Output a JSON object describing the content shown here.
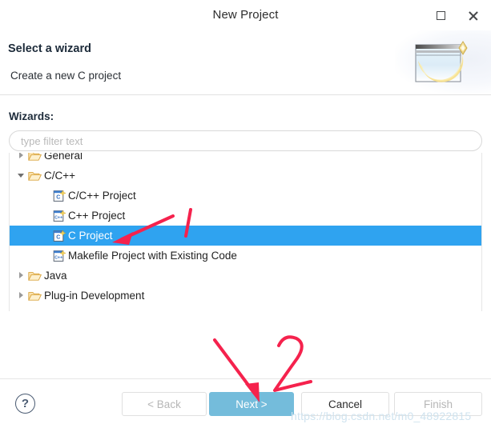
{
  "window": {
    "title": "New Project",
    "controls": [
      {
        "name": "maximize",
        "label": "Maximize"
      },
      {
        "name": "close",
        "label": "Close"
      }
    ]
  },
  "banner": {
    "title": "Select a wizard",
    "subtitle": "Create a new C project",
    "icon": "new-project-wizard-icon"
  },
  "wizards": {
    "label": "Wizards:",
    "filter_placeholder": "type filter text",
    "filter_value": "",
    "tree": [
      {
        "label": "General",
        "type": "folder",
        "indent": 1,
        "state": "collapsed",
        "selected": false,
        "clipped": "top"
      },
      {
        "label": "C/C++",
        "type": "folder",
        "indent": 1,
        "state": "expanded",
        "selected": false
      },
      {
        "label": "C/C++ Project",
        "type": "c-file",
        "indent": 2,
        "state": "leaf",
        "selected": false
      },
      {
        "label": "C++ Project",
        "type": "cpp-file",
        "indent": 2,
        "state": "leaf",
        "selected": false
      },
      {
        "label": "C Project",
        "type": "c-file",
        "indent": 2,
        "state": "leaf",
        "selected": true
      },
      {
        "label": "Makefile Project with Existing Code",
        "type": "cpp-file",
        "indent": 2,
        "state": "leaf",
        "selected": false
      },
      {
        "label": "Java",
        "type": "folder",
        "indent": 1,
        "state": "collapsed",
        "selected": false
      },
      {
        "label": "Plug-in Development",
        "type": "folder",
        "indent": 1,
        "state": "collapsed",
        "selected": false,
        "clipped": "bottom"
      }
    ]
  },
  "footer": {
    "help_label": "?",
    "buttons": [
      {
        "name": "back",
        "label": "< Back",
        "enabled": false,
        "primary": false
      },
      {
        "name": "next",
        "label": "Next >",
        "enabled": true,
        "primary": true
      },
      {
        "name": "cancel",
        "label": "Cancel",
        "enabled": true,
        "primary": false
      },
      {
        "name": "finish",
        "label": "Finish",
        "enabled": false,
        "primary": false
      }
    ]
  },
  "annotations": [
    {
      "name": "arrow-1",
      "kind": "arrow",
      "target": "C Project row"
    },
    {
      "name": "digit-1",
      "kind": "handwritten-digit",
      "text": "1"
    },
    {
      "name": "arrow-2",
      "kind": "arrow",
      "target": "Next > button"
    },
    {
      "name": "digit-2",
      "kind": "handwritten-digit",
      "text": "2"
    }
  ],
  "watermark": {
    "text": "https://blog.csdn.net/m0_48922815"
  },
  "colors": {
    "selection_blue": "#2fa3f0",
    "primary_button": "#74bcdb",
    "annotation_red": "#f5224d",
    "folder_yellow": "#f0b350",
    "watermark": "#cfe3ef"
  }
}
